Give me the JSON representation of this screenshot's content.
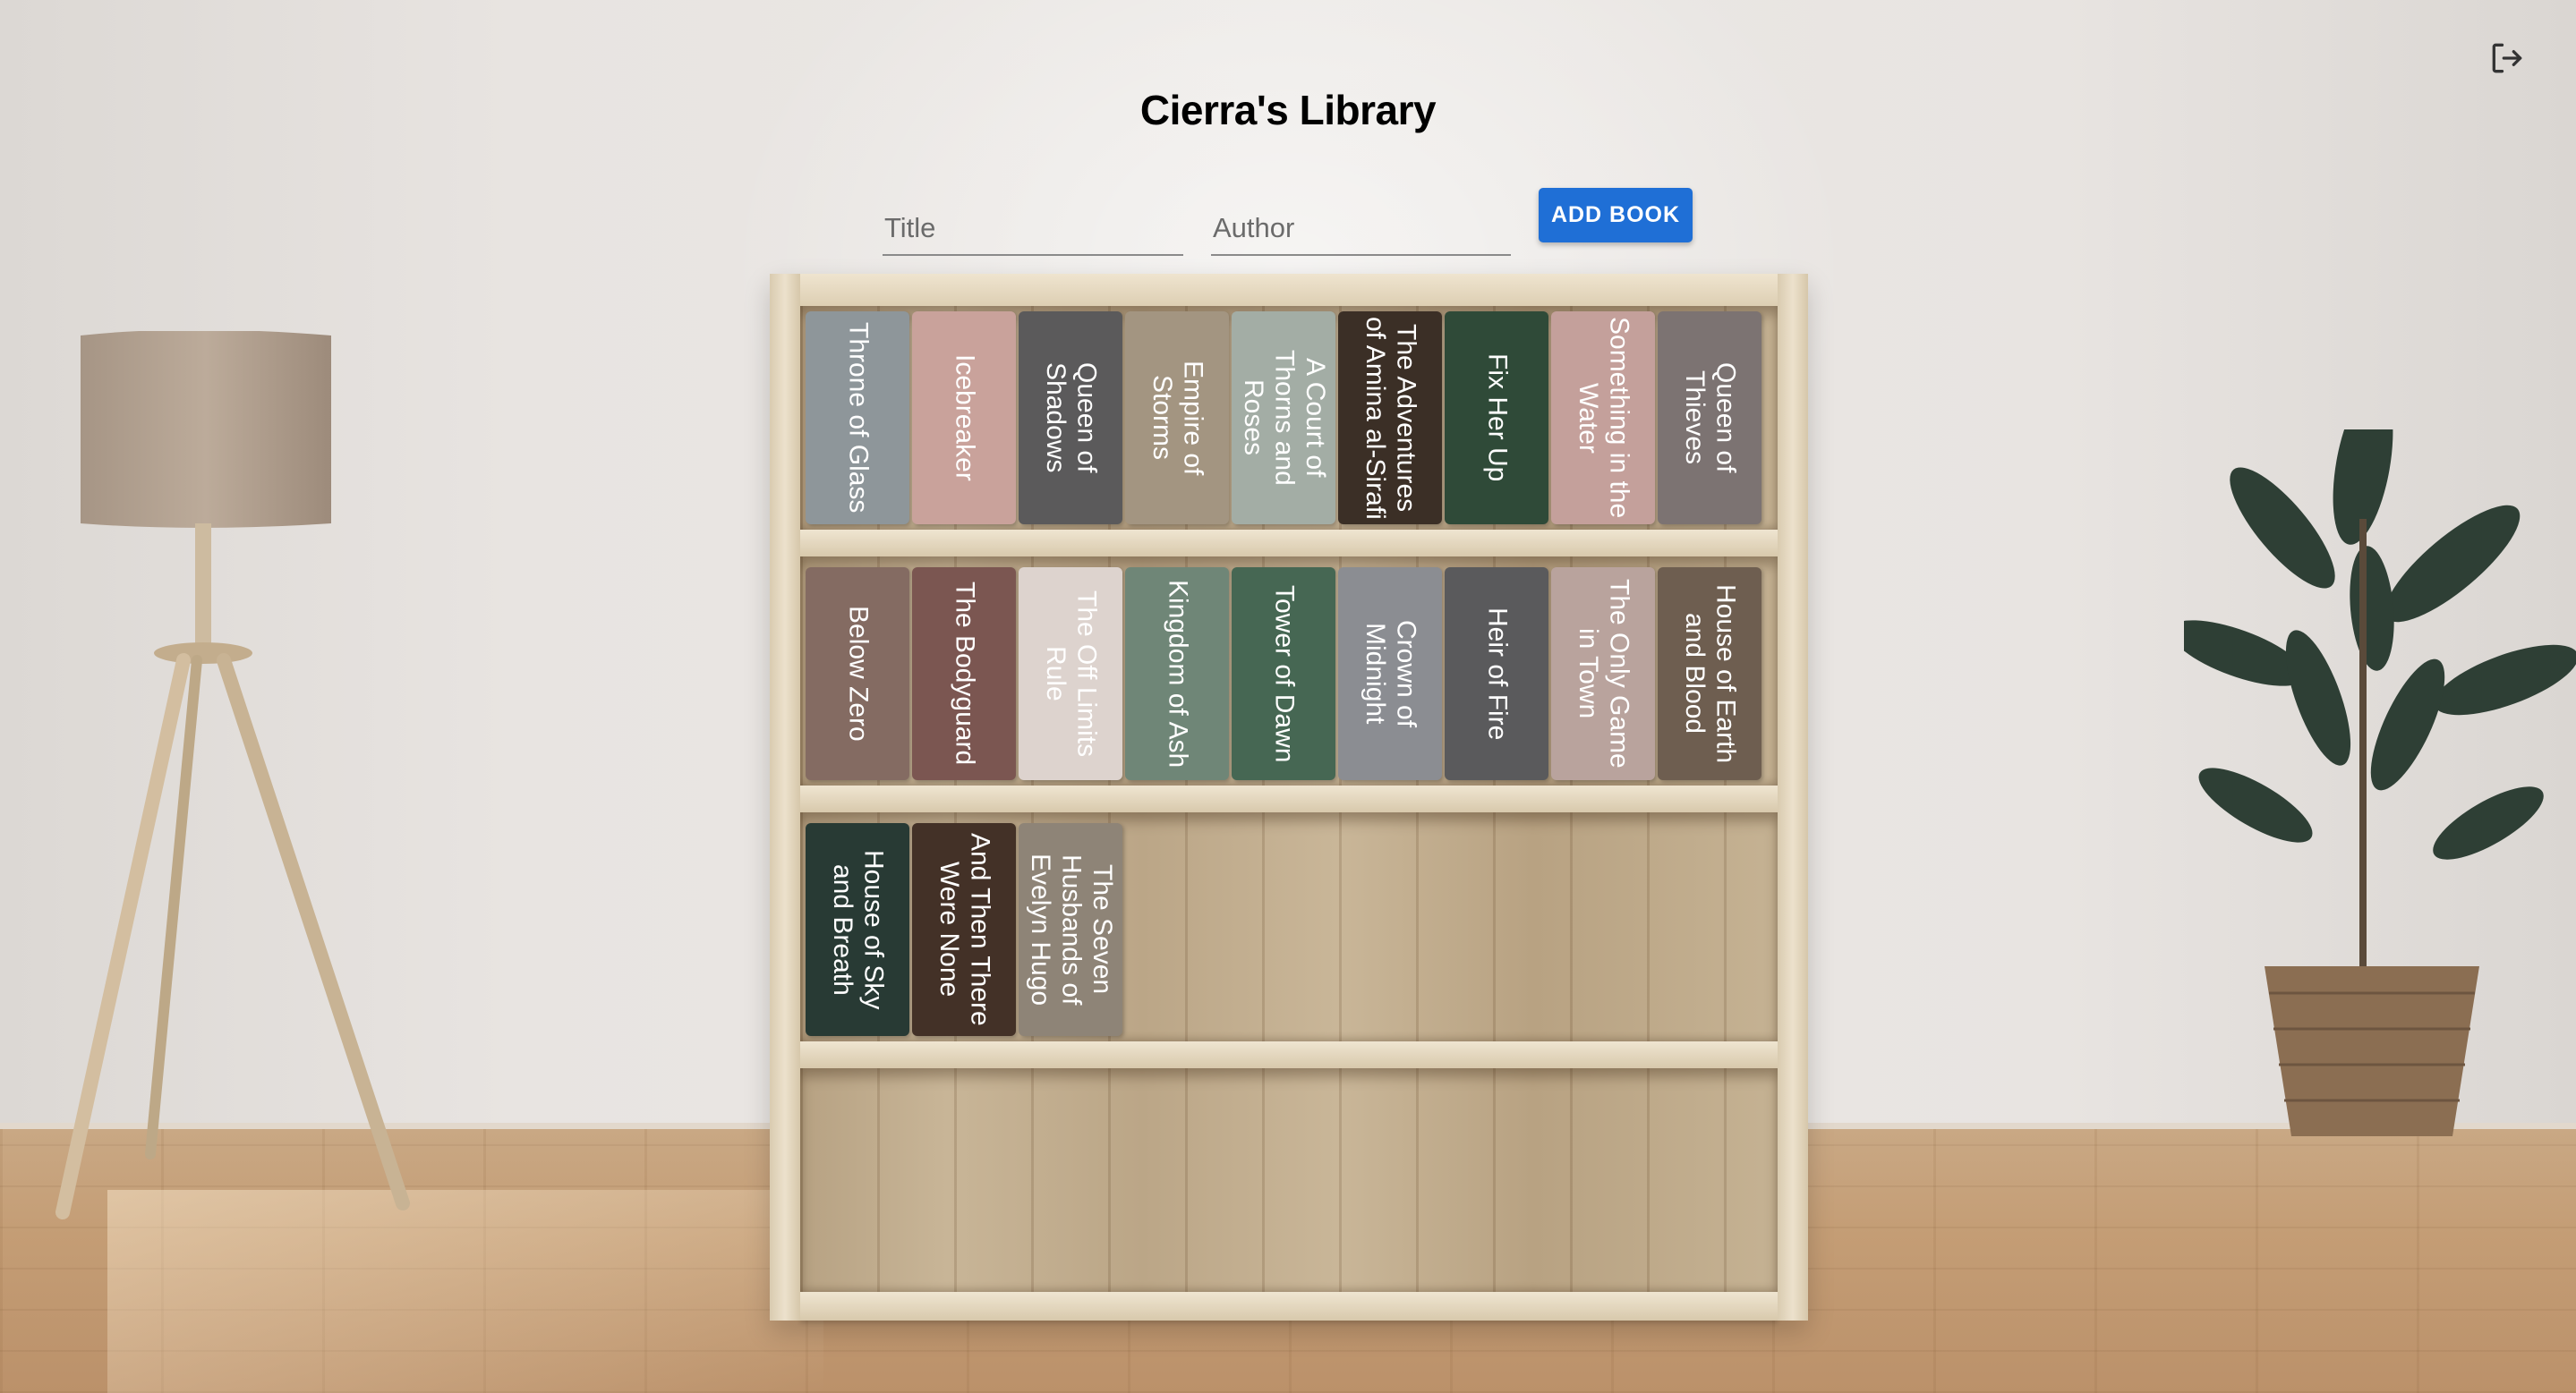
{
  "page": {
    "title": "Cierra's Library"
  },
  "form": {
    "title_placeholder": "Title",
    "author_placeholder": "Author",
    "add_button_label": "ADD BOOK"
  },
  "icons": {
    "logout": "logout-icon"
  },
  "colors": {
    "accent": "#1f6fd6"
  },
  "shelves": [
    {
      "books": [
        {
          "title": "Throne of Glass",
          "color": "#8e969a"
        },
        {
          "title": "Icebreaker",
          "color": "#c9a29b"
        },
        {
          "title": "Queen of Shadows",
          "color": "#5b5a5b"
        },
        {
          "title": "Empire of Storms",
          "color": "#a39581"
        },
        {
          "title": "A Court of Thorns and Roses",
          "color": "#a3ada5"
        },
        {
          "title": "The Adventures of Amina al-Sirafi",
          "color": "#3b2f26"
        },
        {
          "title": "Fix Her Up",
          "color": "#2f4a38"
        },
        {
          "title": "Something in the Water",
          "color": "#c4a09b"
        },
        {
          "title": "Queen of Thieves",
          "color": "#7c7372"
        }
      ]
    },
    {
      "books": [
        {
          "title": "Below Zero",
          "color": "#846b62"
        },
        {
          "title": "The Bodyguard",
          "color": "#7b5651"
        },
        {
          "title": "The Off Limits Rule",
          "color": "#ddd3ce"
        },
        {
          "title": "Kingdom of Ash",
          "color": "#6f8677"
        },
        {
          "title": "Tower of Dawn",
          "color": "#466753"
        },
        {
          "title": "Crown of Midnight",
          "color": "#8b8d92"
        },
        {
          "title": "Heir of Fire",
          "color": "#5a5a5c"
        },
        {
          "title": "The Only Game in Town",
          "color": "#b9a39d"
        },
        {
          "title": "House of Earth and Blood",
          "color": "#6e5e50"
        }
      ]
    },
    {
      "books": [
        {
          "title": "House of Sky and Breath",
          "color": "#283a34"
        },
        {
          "title": "And Then There Were None",
          "color": "#433127"
        },
        {
          "title": "The Seven Husbands of Evelyn Hugo",
          "color": "#8e8477"
        }
      ]
    },
    {
      "books": []
    }
  ]
}
